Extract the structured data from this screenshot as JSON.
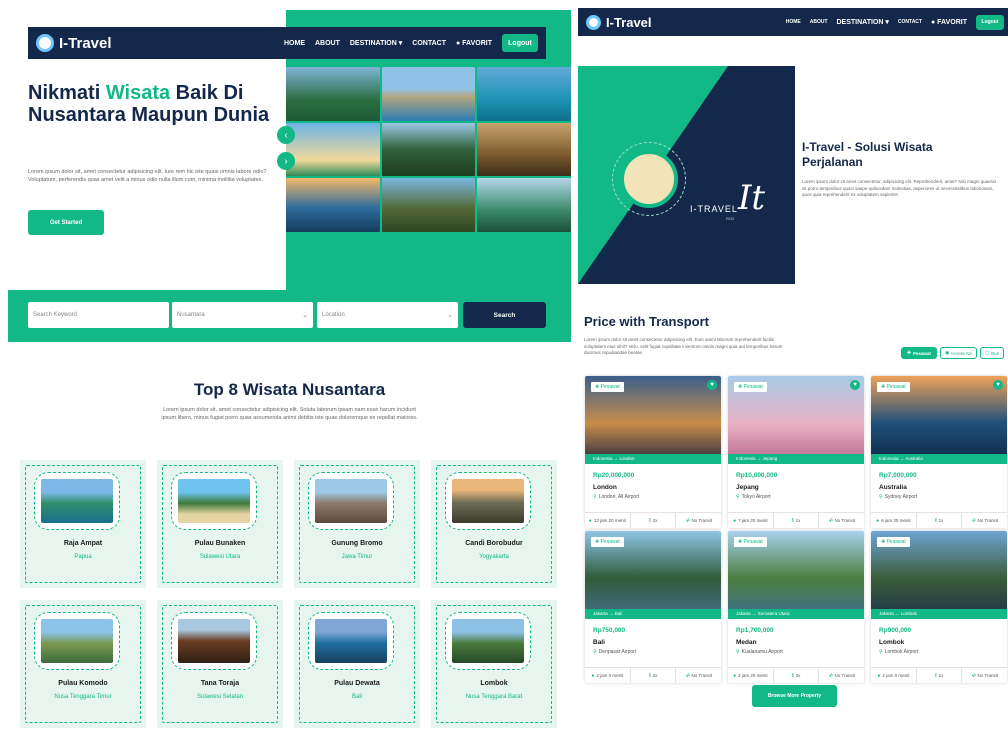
{
  "left": {
    "brand": "I-Travel",
    "nav": [
      "HOME",
      "ABOUT",
      "DESTINATION",
      "CONTACT",
      "FAVORIT"
    ],
    "logout": "Logout",
    "hero": {
      "title_part1": "Nikmati ",
      "title_highlight": "Wisata",
      "title_part2": " Baik Di Nusantara Maupun Dunia",
      "desc": "Lorem ipsum dolor sit, amet consectetur adipisicing elit. Iure rem hic iste quasi omnis labore odio? Voluptatum, perferendis quas amet velit a minus odio nulla illum cum, minima mollitia voluptates.",
      "cta": "Get Started"
    },
    "search": {
      "keyword_placeholder": "Search Keyword",
      "region": "Nusantara",
      "location": "Location",
      "button": "Search"
    },
    "section": {
      "title": "Top 8 Wisata Nusantara",
      "desc": "Lorem ipsum dolor sit, amet consectetur adipisicing elit. Soluta laborum ipsam nam esse harum incidunt ipsum libero, minus fugiat porro quas assumenda animi debitis iste quae doloremque ex repellat maiores."
    },
    "destinations": [
      {
        "name": "Raja Ampat",
        "region": "Papua"
      },
      {
        "name": "Pulau Bunaken",
        "region": "Sulawesi Utara"
      },
      {
        "name": "Gunung Bromo",
        "region": "Jawa Timur"
      },
      {
        "name": "Candi Borobudur",
        "region": "Yogyakarta"
      },
      {
        "name": "Pulau Komodo",
        "region": "Nusa Tenggara Timur"
      },
      {
        "name": "Tana Toraja",
        "region": "Sulawesi Selatan"
      },
      {
        "name": "Pulau Dewata",
        "region": "Bali"
      },
      {
        "name": "Lombok",
        "region": "Nusa Tenggara Barat"
      }
    ]
  },
  "right": {
    "brand": "I-Travel",
    "nav": [
      "HOME",
      "ABOUT",
      "DESTINATION",
      "CONTACT",
      "FAVORIT"
    ],
    "logout": "Logout",
    "banner_logo": "I-TRAVEL",
    "banner_logo_sub": "RO2",
    "banner_mono": "It",
    "about": {
      "title": "I-Travel - Solusi Wisata Perjalanan",
      "desc": "Lorem ipsum dolor sit amet consectetur, adipisicing elit. Reprehenderit, amet? Nisi magni quaerat sit porro temporibus quasi saepe quibusdam molestias, asperiores ut necessitatibus laboriosam, quos quia reprehenderit ex voluptatem sapiente!"
    },
    "transport": {
      "title": "Price with Transport",
      "desc": "Lorem ipsum dolor sit amet consectetur adipisicing elit. Eum animi laborum reprehenderit facilis voluptatem eius nihil? Vero, velit fugiat cupiditate inventore omnis magni quia aut temporibus harum ducimus repudiandae beatae.",
      "filters": [
        "Pesawat",
        "Kereta Api",
        "Bus"
      ]
    },
    "trips": [
      {
        "tag": "Pesawat",
        "route": "Indonesia → London",
        "price": "Rp20,000,000",
        "city": "London",
        "airport": "London, All Airport",
        "time": "13 jam 20 menit",
        "pax": "2x",
        "transit": "No Transit"
      },
      {
        "tag": "Pesawat",
        "route": "Indonesia → Jepang",
        "price": "Rp10,000,000",
        "city": "Jepang",
        "airport": "Tokyo Airport",
        "time": "7 jam 20 menit",
        "pax": "1x",
        "transit": "No Transit"
      },
      {
        "tag": "Pesawat",
        "route": "Indonesia → Australia",
        "price": "Rp7,000,000",
        "city": "Australia",
        "airport": "Sydney Airport",
        "time": "6 jam 30 menit",
        "pax": "1x",
        "transit": "No Transit"
      },
      {
        "tag": "Pesawat",
        "route": "Jakarta → Bali",
        "price": "Rp750,000",
        "city": "Bali",
        "airport": "Denpasar Airport",
        "time": "2 jam 0 menit",
        "pax": "2x",
        "transit": "No Transit"
      },
      {
        "tag": "Pesawat",
        "route": "Jakarta → Sumatera Utara",
        "price": "Rp1,700,000",
        "city": "Medan",
        "airport": "Kualanamu Airport",
        "time": "2 jam 20 menit",
        "pax": "3x",
        "transit": "No Transit"
      },
      {
        "tag": "Pesawat",
        "route": "Jakarta → Lombok",
        "price": "Rp900,000",
        "city": "Lombok",
        "airport": "Lombok Airport",
        "time": "2 jam 0 menit",
        "pax": "1x",
        "transit": "No Transit"
      }
    ],
    "browse": "Browse More Property"
  },
  "colors": {
    "accent": "#12b886",
    "navy": "#14284b"
  }
}
